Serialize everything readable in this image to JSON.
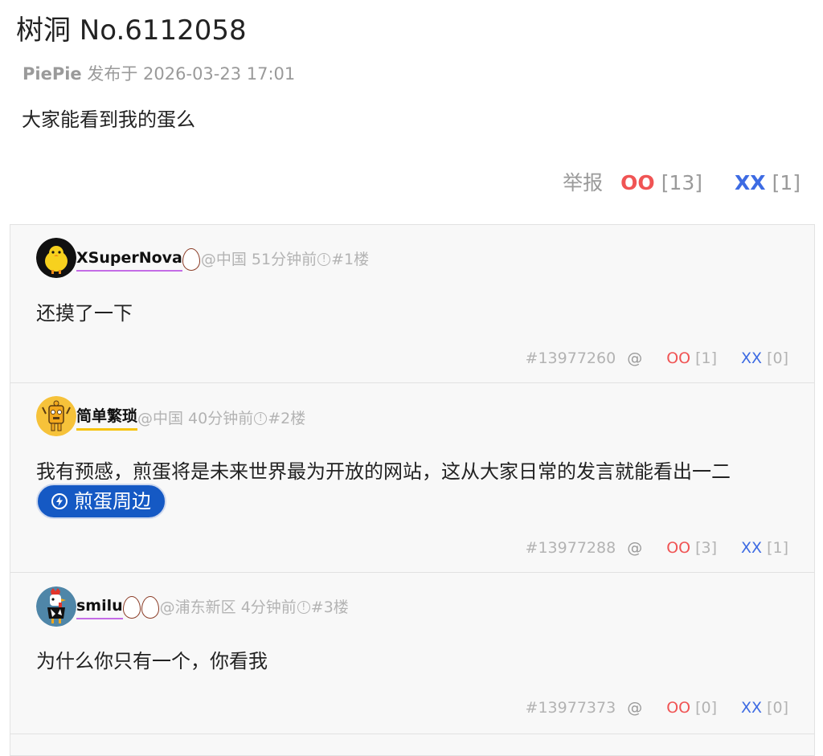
{
  "post": {
    "title": "树洞 No.6112058",
    "author": "PiePie",
    "published_label": "发布于",
    "datetime": "2026-03-23 17:01",
    "body": "大家能看到我的蛋么",
    "report_label": "举报",
    "oo_label": "OO",
    "oo_count": "[13]",
    "xx_label": "XX",
    "xx_count": "[1]"
  },
  "comments": [
    {
      "username": "XSuperNova",
      "eggs": 1,
      "location": "@中国",
      "time": "51分钟前",
      "floor": "#1楼",
      "body": "还摸了一下",
      "post_id": "#13977260",
      "at_label": "@",
      "oo_label": "OO",
      "oo_count": "[1]",
      "xx_label": "XX",
      "xx_count": "[0]",
      "avatar_icon": "chick-avatar-icon"
    },
    {
      "username": "简单繁琐",
      "eggs": 0,
      "location": "@中国",
      "time": "40分钟前",
      "floor": "#2楼",
      "body": "我有预感，煎蛋将是未来世界最为开放的网站，这从大家日常的发言就能看出一二",
      "tag_label": "煎蛋周边",
      "post_id": "#13977288",
      "at_label": "@",
      "oo_label": "OO",
      "oo_count": "[3]",
      "xx_label": "XX",
      "xx_count": "[1]",
      "avatar_icon": "yellow-character-avatar-icon"
    },
    {
      "username": "smilu",
      "eggs": 2,
      "location": "@浦东新区",
      "time": "4分钟前",
      "floor": "#3楼",
      "body": "为什么你只有一个，你看我",
      "post_id": "#13977373",
      "at_label": "@",
      "oo_label": "OO",
      "oo_count": "[0]",
      "xx_label": "XX",
      "xx_count": "[0]",
      "avatar_icon": "rooster-avatar-icon"
    }
  ],
  "colors": {
    "oo": "#f05454",
    "xx": "#3d6be3",
    "tag_button": "#1559c4",
    "muted": "#b3b3b3"
  }
}
